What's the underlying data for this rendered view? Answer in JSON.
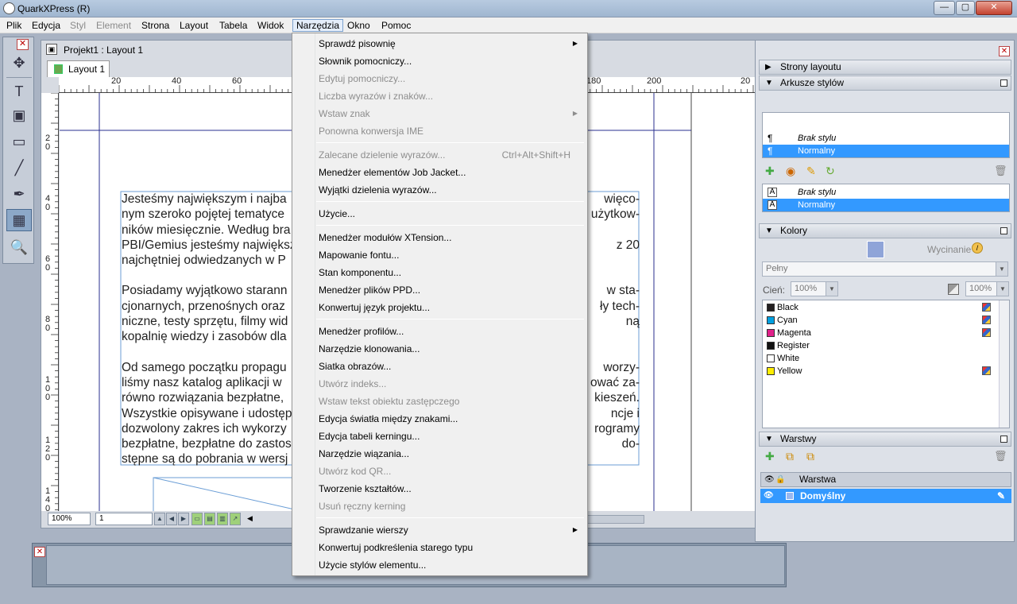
{
  "app": {
    "title": "QuarkXPress (R)"
  },
  "menubar": [
    {
      "label": "Plik",
      "dis": false
    },
    {
      "label": "Edycja",
      "dis": false
    },
    {
      "label": "Styl",
      "dis": true
    },
    {
      "label": "Element",
      "dis": true
    },
    {
      "label": "Strona",
      "dis": false
    },
    {
      "label": "Layout",
      "dis": false
    },
    {
      "label": "Tabela",
      "dis": false
    },
    {
      "label": "Widok",
      "dis": false
    },
    {
      "label": "Narzędzia",
      "dis": false,
      "open": true
    },
    {
      "label": "Okno",
      "dis": false
    },
    {
      "label": "Pomoc",
      "dis": false
    }
  ],
  "window_controls": {
    "minimize": "—",
    "maximize": "▢",
    "close": "✕"
  },
  "document": {
    "title": "Projekt1 : Layout 1",
    "tab": "Layout 1",
    "zoom": "100%",
    "page": "1"
  },
  "ruler": {
    "h_labels": [
      "20",
      "40",
      "60",
      "180",
      "200",
      "20"
    ],
    "v_labels": [
      "2\n0",
      "4\n0",
      "6\n0",
      "8\n0",
      "1\n0\n0",
      "1\n2\n0",
      "1\n4\n0"
    ]
  },
  "body_text": {
    "p1": [
      "Jesteśmy największym i najba",
      "nym szeroko pojętej tematyce",
      "ników miesięcznie. Według bra",
      "PBI/Gemius jesteśmy największ",
      "najchętniej odwiedzanych w P"
    ],
    "p1_right": [
      "więco-",
      "użytkow-",
      "",
      "z 20",
      ""
    ],
    "p2": [
      "Posiadamy wyjątkowo starann",
      "cjonarnych, przenośnych oraz",
      "niczne, testy sprzętu, filmy wid",
      "kopalnię wiedzy i zasobów dla"
    ],
    "p2_right": [
      "w sta-",
      "ły tech-",
      "ną",
      ""
    ],
    "p3": [
      "Od samego początku propagu",
      "liśmy nasz katalog aplikacji w",
      "równo rozwiązania bezpłatne,",
      "Wszystkie opisywane i udostęp",
      "dozwolony zakres ich wykorzy",
      "bezpłatne, bezpłatne do zastos",
      "stępne są do pobrania w wersj"
    ],
    "p3_right": [
      "worzy-",
      "ować za-",
      "kieszeń.",
      "ncje i",
      "rogramy",
      "do-",
      ""
    ]
  },
  "menu_items": [
    {
      "label": "Sprawdź pisownię",
      "dis": false,
      "arrow": true
    },
    {
      "label": "Słownik pomocniczy...",
      "dis": false
    },
    {
      "label": "Edytuj pomocniczy...",
      "dis": true
    },
    {
      "label": "Liczba wyrazów i znaków...",
      "dis": true
    },
    {
      "label": "Wstaw znak",
      "dis": true,
      "arrow": true
    },
    {
      "label": "Ponowna konwersja IME",
      "dis": true
    },
    {
      "sep": true
    },
    {
      "label": "Zalecane dzielenie wyrazów...",
      "dis": true,
      "shortcut": "Ctrl+Alt+Shift+H"
    },
    {
      "label": "Menedżer elementów Job Jacket...",
      "dis": false
    },
    {
      "label": "Wyjątki dzielenia wyrazów...",
      "dis": false
    },
    {
      "sep": true
    },
    {
      "label": "Użycie...",
      "dis": false
    },
    {
      "sep": true
    },
    {
      "label": "Menedżer modułów XTension...",
      "dis": false
    },
    {
      "label": "Mapowanie fontu...",
      "dis": false
    },
    {
      "label": "Stan komponentu...",
      "dis": false
    },
    {
      "label": "Menedżer plików PPD...",
      "dis": false
    },
    {
      "label": "Konwertuj język projektu...",
      "dis": false
    },
    {
      "sep": true
    },
    {
      "label": "Menedżer profilów...",
      "dis": false
    },
    {
      "label": "Narzędzie klonowania...",
      "dis": false
    },
    {
      "label": "Siatka obrazów...",
      "dis": false
    },
    {
      "label": "Utwórz indeks...",
      "dis": true
    },
    {
      "label": "Wstaw tekst obiektu zastępczego",
      "dis": true
    },
    {
      "label": "Edycja światła między znakami...",
      "dis": false
    },
    {
      "label": "Edycja tabeli kerningu...",
      "dis": false
    },
    {
      "label": "Narzędzie wiązania...",
      "dis": false
    },
    {
      "label": "Utwórz kod QR...",
      "dis": true
    },
    {
      "label": "Tworzenie kształtów...",
      "dis": false
    },
    {
      "label": "Usuń ręczny kerning",
      "dis": true
    },
    {
      "sep": true
    },
    {
      "label": "Sprawdzanie wierszy",
      "dis": false,
      "arrow": true
    },
    {
      "label": "Konwertuj podkreślenia starego typu",
      "dis": false
    },
    {
      "label": "Użycie stylów elementu...",
      "dis": false
    }
  ],
  "panels": {
    "layout_pages": "Strony layoutu",
    "style_sheets": "Arkusze stylów",
    "para_styles": [
      {
        "label": "Brak stylu",
        "italic": true,
        "sel": false
      },
      {
        "label": "Normalny",
        "italic": false,
        "sel": true
      }
    ],
    "char_styles": [
      {
        "label": "Brak stylu",
        "italic": true,
        "sel": false
      },
      {
        "label": "Normalny",
        "italic": false,
        "sel": true
      }
    ],
    "colors": "Kolory",
    "knockout": "Wycinanie",
    "fill": "Pełny",
    "shade_label": "Cień:",
    "shade_value": "100%",
    "opacity_value": "100%",
    "color_list": [
      {
        "name": "Black",
        "hex": "#231f20",
        "icon": true
      },
      {
        "name": "Cyan",
        "hex": "#00a0e0",
        "icon": true
      },
      {
        "name": "Magenta",
        "hex": "#e0218a",
        "icon": true
      },
      {
        "name": "Register",
        "hex": "#111111",
        "icon": false
      },
      {
        "name": "White",
        "hex": "#ffffff",
        "icon": false
      },
      {
        "name": "Yellow",
        "hex": "#ffed00",
        "icon": true
      }
    ],
    "layers": "Warstwy",
    "layer_header": "Warstwa",
    "layer_default": "Domyślny"
  },
  "icons": {
    "para": "¶",
    "char": "A",
    "tri_right": "▶",
    "tri_down": "▼"
  }
}
